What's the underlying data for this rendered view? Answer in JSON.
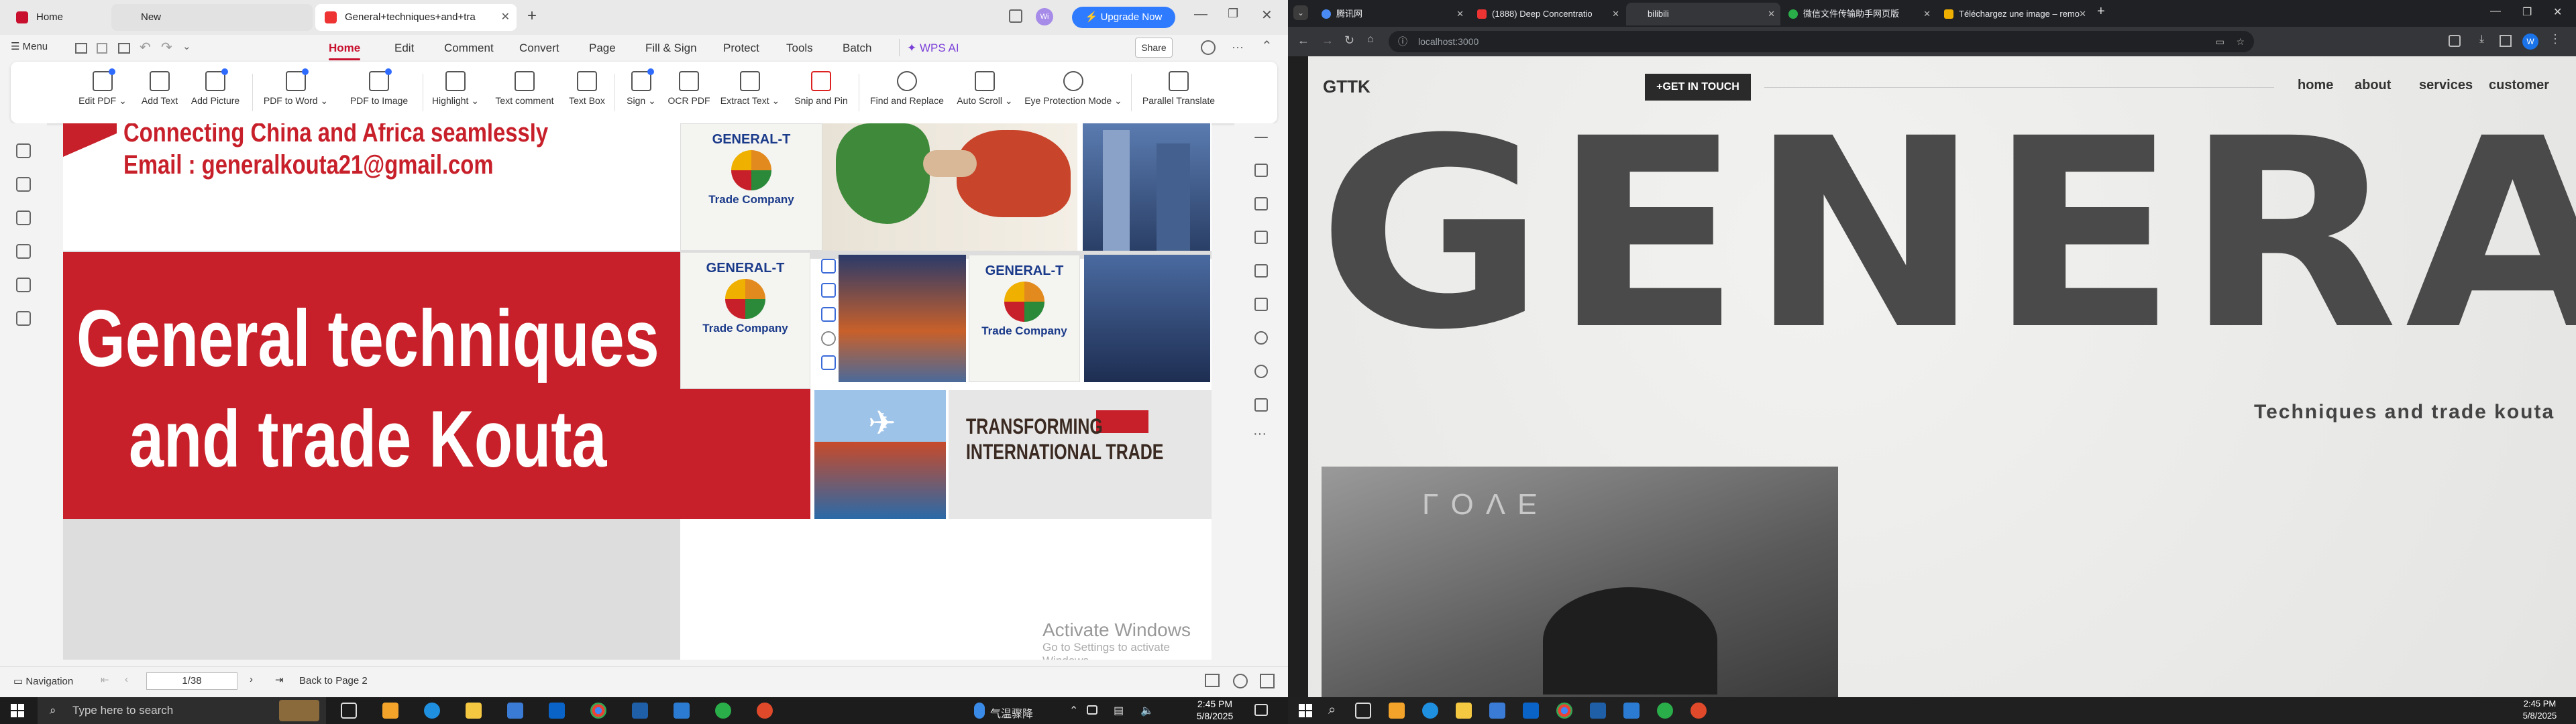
{
  "wps": {
    "tabs": [
      {
        "label": "Home"
      },
      {
        "label": "New"
      },
      {
        "label": "General+techniques+and+tra"
      }
    ],
    "upgrade_label": "Upgrade Now",
    "menu_label": "Menu",
    "menu_tabs": [
      "Home",
      "Edit",
      "Comment",
      "Convert",
      "Page",
      "Fill & Sign",
      "Protect",
      "Tools",
      "Batch",
      "WPS AI"
    ],
    "share_label": "Share",
    "ribbon": [
      "Edit PDF",
      "Add Text",
      "Add Picture",
      "PDF to Word",
      "PDF to Image",
      "Highlight",
      "Text comment",
      "Text Box",
      "Sign",
      "OCR PDF",
      "Extract Text",
      "Snip and Pin",
      "Find and Replace",
      "Auto Scroll",
      "Eye Protection Mode",
      "Parallel Translate"
    ],
    "slide": {
      "tagline": "Connecting China and Africa seamlessly",
      "email": "Email : generalkouta21@gmail.com",
      "title_line1": "General techniques",
      "title_line2": "and trade Kouta",
      "logo_top": "GENERAL-T",
      "logo_bottom": "Trade Company",
      "transform_line1": "TRANSFORMING",
      "transform_line2": "INTERNATIONAL TRADE"
    },
    "watermark": {
      "title": "Activate Windows",
      "sub": "Go to Settings to activate Windows."
    },
    "status": {
      "navigation": "Navigation",
      "page": "1/38",
      "back": "Back to Page 2"
    },
    "colors": {
      "accent": "#c8102e",
      "slide_red": "#c8202a",
      "upgrade": "#2f7bff"
    }
  },
  "chrome": {
    "tabs": [
      {
        "label": "腾讯网"
      },
      {
        "label": "(1888) Deep Concentratio"
      },
      {
        "label": "bilibili"
      },
      {
        "label": "微信文件传输助手网页版"
      },
      {
        "label": "Téléchargez une image – remo"
      }
    ],
    "url": "localhost:3000",
    "profile": "W",
    "site": {
      "brand": "GTTK",
      "cta": "+GET IN TOUCH",
      "nav": [
        "home",
        "about",
        "services",
        "customer"
      ],
      "hero": "GENERAL",
      "subtitle": "Techniques and trade kouta",
      "photo_text": "LOVE"
    }
  },
  "taskbar_left": {
    "search_placeholder": "Type here to search",
    "weather": "气温骤降",
    "time": "2:45 PM",
    "date": "5/8/2025"
  },
  "taskbar_right": {
    "time": "2:45 PM",
    "date": "5/8/2025"
  }
}
